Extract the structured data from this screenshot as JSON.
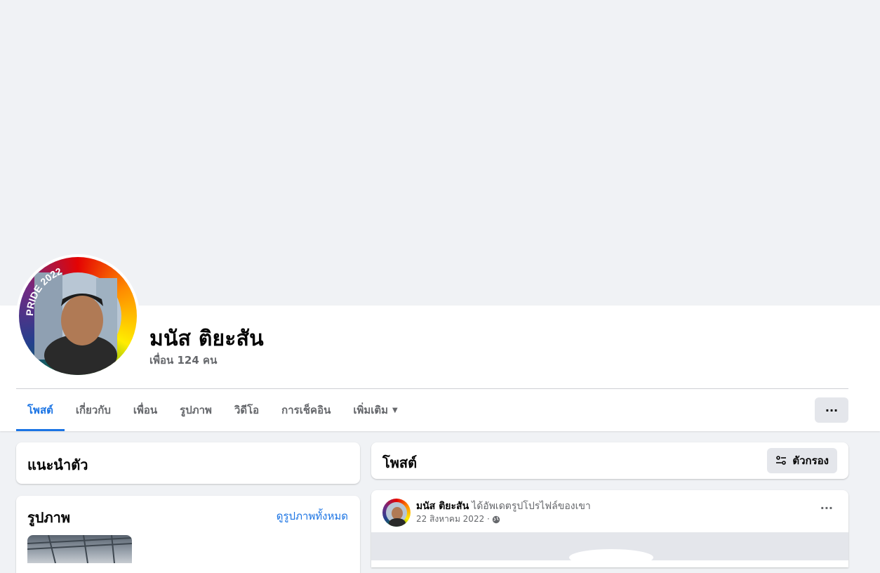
{
  "profile": {
    "name": "มนัส ติยะสัน",
    "friends": "เพื่อน 124 คน",
    "avatar_frame_text": "PRIDE 2022"
  },
  "tabs": [
    {
      "label": "โพสต์",
      "active": true
    },
    {
      "label": "เกี่ยวกับ"
    },
    {
      "label": "เพื่อน"
    },
    {
      "label": "รูปภาพ"
    },
    {
      "label": "วิดีโอ"
    },
    {
      "label": "การเช็คอิน"
    },
    {
      "label": "เพิ่มเติม",
      "caret": "▼"
    }
  ],
  "more_menu_icon": "···",
  "intro": {
    "title": "แนะนำตัว"
  },
  "photos": {
    "title": "รูปภาพ",
    "see_all": "ดูรูปภาพทั้งหมด"
  },
  "posts_header": {
    "title": "โพสต์",
    "filter_label": "ตัวกรอง",
    "filter_icon": "sliders-icon"
  },
  "post": {
    "author": "มนัส ติยะสัน",
    "action": "ได้อัพเดตรูปโปรไฟล์ของเขา",
    "date": "22 สิงหาคม 2022 ·",
    "privacy_icon": "globe-icon",
    "menu_icon": "···"
  },
  "colors": {
    "accent": "#1b74e4",
    "background": "#f0f2f5",
    "secondary_text": "#65676b",
    "button_gray": "#e4e6eb"
  }
}
